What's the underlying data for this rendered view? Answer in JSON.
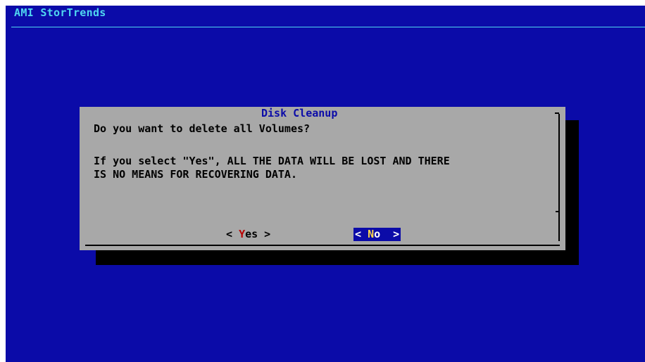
{
  "backtitle": "AMI StorTrends",
  "dialog": {
    "title": "Disk Cleanup",
    "question": "Do you want to delete all Volumes?",
    "warning_line1": "If you select \"Yes\", ALL THE DATA WILL BE LOST AND THERE",
    "warning_line2": "IS NO MEANS FOR RECOVERING DATA."
  },
  "buttons": {
    "yes": {
      "open": "< ",
      "hotkey": "Y",
      "rest": "es",
      "close": " >"
    },
    "no": {
      "open": "< ",
      "hotkey": "N",
      "rest": "o",
      "close": "  >",
      "selected": true
    }
  },
  "colors": {
    "background": "#0b0ba8",
    "backtitle": "#4fd6f0",
    "dialog": "#a8a8a8",
    "title": "#0b0ba8",
    "hotkey": "#b80000",
    "selected_hotkey": "#ffd84a"
  }
}
